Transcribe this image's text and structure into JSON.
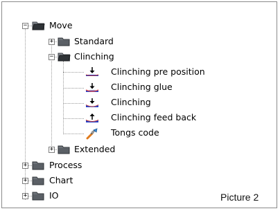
{
  "tree": {
    "move": {
      "label": "Move"
    },
    "standard": {
      "label": "Standard"
    },
    "clinching": {
      "label": "Clinching"
    },
    "children": [
      {
        "label": "Clinching pre position"
      },
      {
        "label": "Clinching glue"
      },
      {
        "label": "Clinching"
      },
      {
        "label": "Clinching feed back"
      },
      {
        "label": "Tongs code"
      }
    ],
    "extended": {
      "label": "Extended"
    },
    "process": {
      "label": "Process"
    },
    "chart": {
      "label": "Chart"
    },
    "io": {
      "label": "IO"
    },
    "expand_symbol": "+",
    "collapse_symbol": "−"
  },
  "caption": "Picture 2"
}
